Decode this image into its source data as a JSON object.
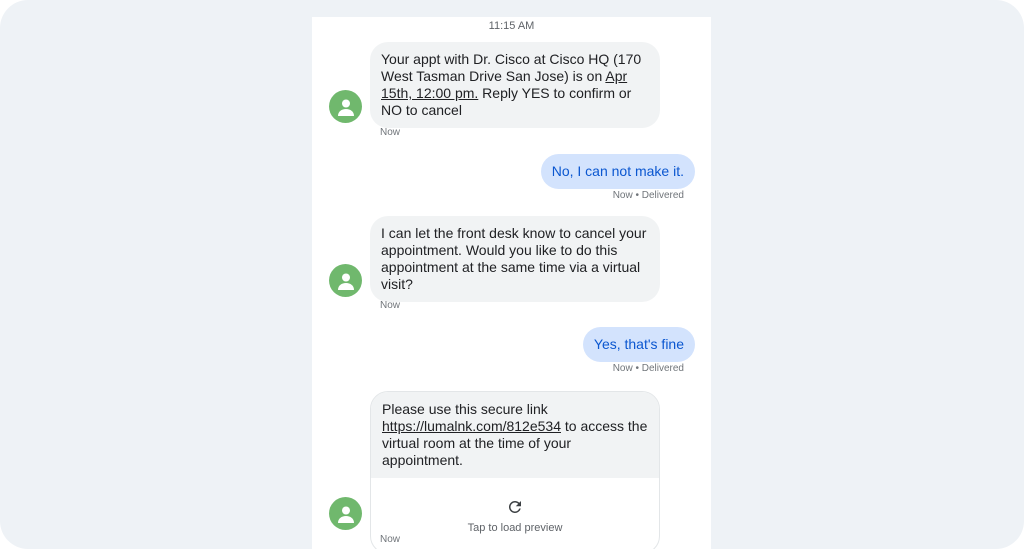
{
  "thread": {
    "top_time": "11:15 AM",
    "messages": [
      {
        "direction": "incoming",
        "parts": [
          {
            "text": "Your appt with Dr. Cisco at Cisco HQ (170 West Tasman Drive San Jose) is on "
          },
          {
            "text": "Apr 15th, 12:00 pm.",
            "link": true
          },
          {
            "text": " Reply YES to confirm or NO to cancel"
          }
        ],
        "meta": "Now"
      },
      {
        "direction": "outgoing",
        "text": "No, I can not make it.",
        "meta": "Now • Delivered"
      },
      {
        "direction": "incoming",
        "text": "I can let the front desk know to cancel your appointment. Would you like to do this appointment at the same time via a virtual visit?",
        "meta": "Now"
      },
      {
        "direction": "outgoing",
        "text": "Yes, that's fine",
        "meta": "Now • Delivered"
      },
      {
        "direction": "incoming",
        "parts": [
          {
            "text": "Please use this secure link "
          },
          {
            "text": "https://lumalnk.com/812e534",
            "link": true
          },
          {
            "text": " to access the virtual room at the time of your appointment."
          }
        ],
        "preview_label": "Tap to load preview",
        "meta": "Now"
      }
    ]
  },
  "colors": {
    "background": "#eef2f6",
    "incoming_bubble": "#f1f3f4",
    "outgoing_bubble": "#d3e3fd",
    "outgoing_text": "#0b57d0",
    "avatar": "#70b86d"
  },
  "icons": {
    "avatar": "person-icon",
    "preview": "refresh-icon"
  }
}
